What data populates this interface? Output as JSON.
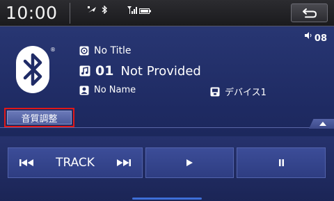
{
  "status_bar": {
    "clock": "10:00",
    "icons": [
      "gps-icon",
      "bluetooth-icon",
      "signal-icon",
      "battery-icon"
    ]
  },
  "back_button": {
    "icon": "back-arrow-icon"
  },
  "volume": {
    "icon": "speaker-icon",
    "value": "08"
  },
  "source": {
    "logo": "bluetooth-logo",
    "registered_mark": "®"
  },
  "track_info": {
    "album": "No Title",
    "track_number": "01",
    "track_title": "Not Provided",
    "artist": "No Name",
    "device": "デバイス1"
  },
  "sound_adjust_button": {
    "label": "音質調整"
  },
  "controls": {
    "track_label": "TRACK",
    "prev_icon": "skip-previous-icon",
    "next_icon": "skip-next-icon",
    "play_icon": "play-icon",
    "pause_icon": "pause-icon"
  },
  "colors": {
    "background_top": "#2b3a78",
    "highlight_border": "#e01818",
    "button_fill": "#3c4d98"
  }
}
